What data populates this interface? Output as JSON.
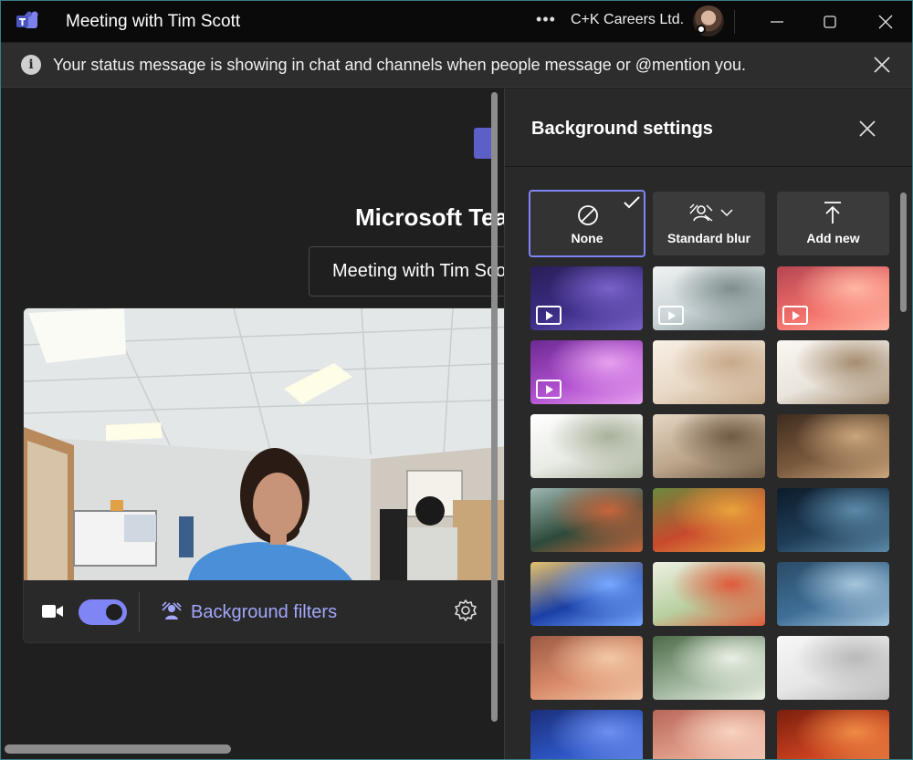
{
  "window": {
    "title": "Meeting with Tim Scott",
    "more_label": "•••",
    "org": "C+K Careers Ltd."
  },
  "notice": {
    "text": "Your status message is showing in chat and channels when people message or @mention you."
  },
  "prejoin": {
    "heading": "Microsoft Teams",
    "meeting_name": "Meeting with Tim Scott",
    "camera_on": true,
    "background_filters_label": "Background filters"
  },
  "background_settings": {
    "title": "Background settings",
    "options": [
      {
        "label": "None",
        "icon": "no-background-icon",
        "selected": true
      },
      {
        "label": "Standard blur",
        "icon": "blur-icon",
        "selected": false
      },
      {
        "label": "Add new",
        "icon": "upload-icon",
        "selected": false
      }
    ],
    "backgrounds": [
      {
        "name": "purple-mountains",
        "video": true,
        "colors": [
          "#3c2d86",
          "#7a62c9",
          "#2a1f58"
        ]
      },
      {
        "name": "misty-pines",
        "video": true,
        "colors": [
          "#c9d3d6",
          "#7f8e8c",
          "#f0f2f2"
        ]
      },
      {
        "name": "pink-clouds",
        "video": true,
        "colors": [
          "#f26f6a",
          "#ffb7a3",
          "#b54653"
        ]
      },
      {
        "name": "pink-flowers",
        "video": true,
        "colors": [
          "#b04fcf",
          "#e6a1ef",
          "#6c2a92"
        ]
      },
      {
        "name": "minimal-room",
        "video": false,
        "colors": [
          "#e8d9c6",
          "#c7a98a",
          "#f7efe6"
        ]
      },
      {
        "name": "bright-living-room",
        "video": false,
        "colors": [
          "#e9e4dc",
          "#a58d70",
          "#faf7f2"
        ]
      },
      {
        "name": "white-arches",
        "video": false,
        "colors": [
          "#e9ebe6",
          "#a9b19b",
          "#ffffff"
        ]
      },
      {
        "name": "beige-lounge",
        "video": false,
        "colors": [
          "#bba58a",
          "#6f5a45",
          "#e5d6c3"
        ]
      },
      {
        "name": "wood-cabin",
        "video": false,
        "colors": [
          "#7a5a3e",
          "#caa57c",
          "#3e2c1f"
        ]
      },
      {
        "name": "glass-garden-house",
        "video": false,
        "colors": [
          "#2d4a3b",
          "#c7653b",
          "#9cb7b0"
        ]
      },
      {
        "name": "colorful-courtyard",
        "video": false,
        "colors": [
          "#c8492e",
          "#e8a33c",
          "#6b8a3e"
        ]
      },
      {
        "name": "desert-planet",
        "video": false,
        "colors": [
          "#1f3d57",
          "#5c8aa8",
          "#0d1b2a"
        ]
      },
      {
        "name": "space-warp",
        "video": false,
        "colors": [
          "#1a3fa6",
          "#76a8ff",
          "#e8c26a"
        ]
      },
      {
        "name": "green-arches",
        "video": false,
        "colors": [
          "#b8cfa0",
          "#e05a3a",
          "#eef0e2"
        ]
      },
      {
        "name": "blue-dome",
        "video": false,
        "colors": [
          "#3f6f96",
          "#a7c6dd",
          "#2a4c68"
        ]
      },
      {
        "name": "desert-arch",
        "video": false,
        "colors": [
          "#d98b6a",
          "#f2c8a7",
          "#9c5a44"
        ]
      },
      {
        "name": "circle-window",
        "video": false,
        "colors": [
          "#9fb49c",
          "#e9efe4",
          "#4d6b49"
        ]
      },
      {
        "name": "white-doorway",
        "video": false,
        "colors": [
          "#e6e6e6",
          "#b9b9b9",
          "#f7f7f7"
        ]
      },
      {
        "name": "blue-partial",
        "video": false,
        "colors": [
          "#2d56c4",
          "#6f8ff0",
          "#1b2f7a"
        ]
      },
      {
        "name": "peach-partial",
        "video": false,
        "colors": [
          "#e2a08b",
          "#f7d2c1",
          "#b9675a"
        ]
      },
      {
        "name": "orange-partial",
        "video": false,
        "colors": [
          "#c8401f",
          "#ef8b46",
          "#7a1f0e"
        ]
      }
    ]
  },
  "colors": {
    "accent": "#7f85f5",
    "accent_text": "#a2a7fb",
    "brand_purple": "#5b5fc7"
  }
}
